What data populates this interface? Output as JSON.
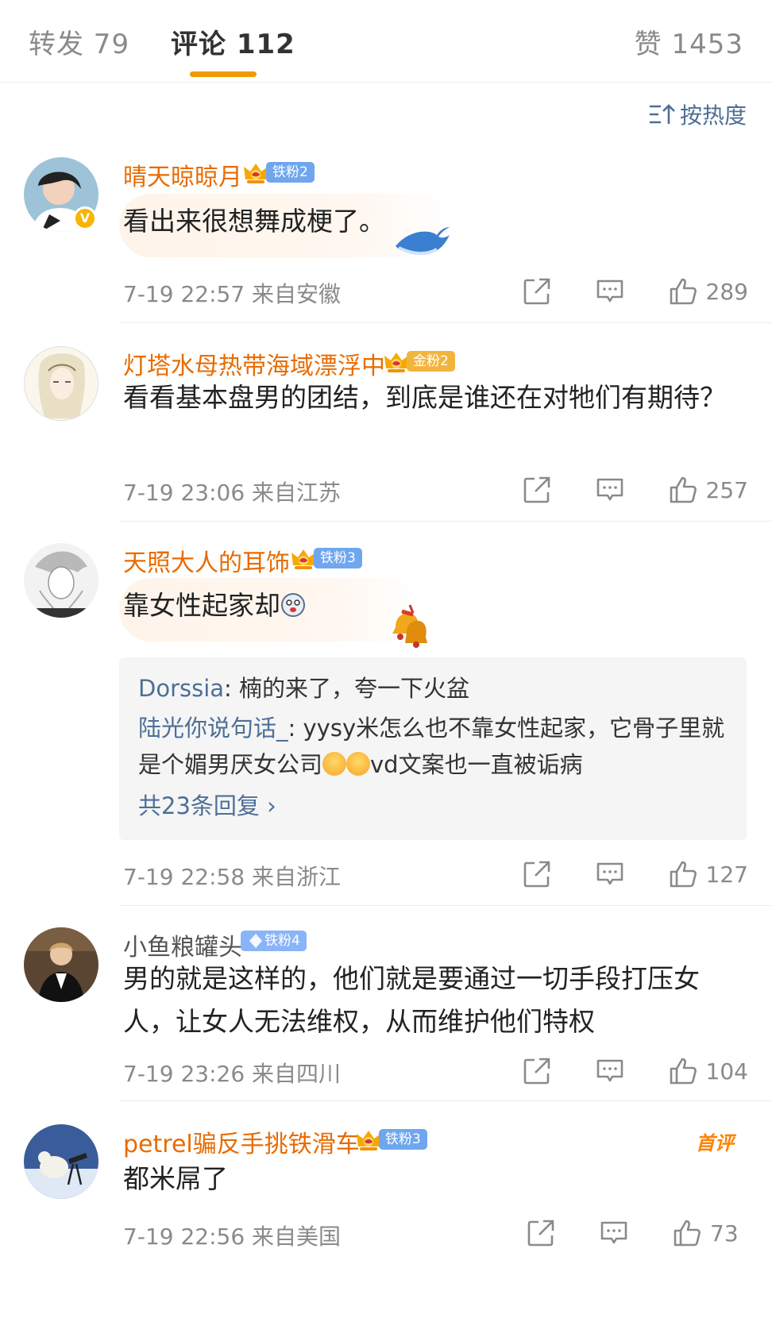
{
  "tabs": {
    "repost": "转发 79",
    "comments": "评论 112",
    "likes": "赞 1453"
  },
  "sort": {
    "label": "按热度"
  },
  "comments": [
    {
      "user": "晴天晾晾月",
      "fan_badge": "铁粉2",
      "text": "看出来很想舞成梗了。",
      "time": "7-19 22:57 来自安徽",
      "likes": "289",
      "verified": "V"
    },
    {
      "user": "灯塔水母热带海域漂浮中",
      "fan_badge": "金粉2",
      "text": "看看基本盘男的团结，到底是谁还在对牠们有期待？",
      "time": "7-19 23:06 来自江苏",
      "likes": "257"
    },
    {
      "user": "天照大人的耳饰",
      "fan_badge": "铁粉3",
      "text": "靠女性起家却",
      "replies": [
        {
          "name": "Dorssia",
          "text": "楠的来了，夸一下火盆"
        },
        {
          "name": "陆光你说句话_",
          "text": "yysy米怎么也不靠女性起家，它骨子里就是个媚男厌女公司",
          "text_after": "vd文案也一直被诟病"
        }
      ],
      "more_replies": "共23条回复 ›",
      "time": "7-19 22:58 来自浙江",
      "likes": "127"
    },
    {
      "user": "小鱼粮罐头",
      "fan_badge": "铁粉4",
      "text": "男的就是这样的，他们就是要通过一切手段打压女人，让女人无法维权，从而维护他们特权",
      "time": "7-19 23:26 来自四川",
      "likes": "104"
    },
    {
      "user": "petrel骗反手挑铁滑车",
      "fan_badge": "铁粉3",
      "first_badge": "首评",
      "text": "都米屌了",
      "time": "7-19 22:56 来自美国",
      "likes": "73"
    }
  ],
  "colors": {
    "accent": "#f09a00",
    "username_orange": "#e86b00",
    "link_blue": "#4d6f96",
    "meta_gray": "#8a8a8a"
  },
  "icons": [
    "sort-icon",
    "share-icon",
    "comment-icon",
    "like-icon",
    "crown-icon",
    "diamond-icon"
  ]
}
